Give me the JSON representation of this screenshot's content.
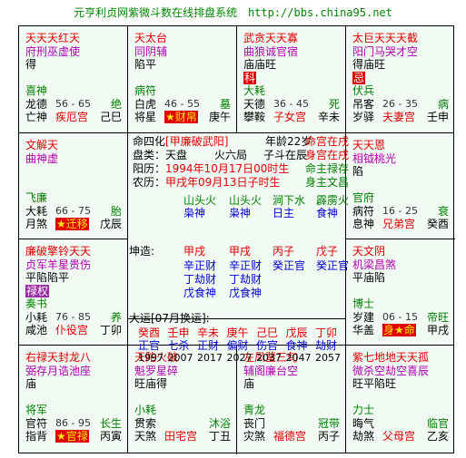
{
  "header": {
    "title": "元亨利贞网紫微斗数在线排盘系统",
    "url": "http://bbs.china95.net"
  },
  "palaces": {
    "p0": {
      "stars_top": [
        [
          "天天天红天",
          "red"
        ],
        [
          "府刑巫虚使",
          "pur"
        ]
      ],
      "line3": [
        [
          "得",
          "blk"
        ]
      ],
      "god": "喜神",
      "r1": [
        "龙德",
        "56 - 65",
        "绝"
      ],
      "r2": [
        "亡神",
        "疾厄宫",
        "己巳"
      ]
    },
    "p1": {
      "stars_top": [
        [
          "天太台",
          "red"
        ],
        [
          "同阴辅",
          "pur"
        ]
      ],
      "line3": [
        [
          "陷平",
          "blk"
        ]
      ],
      "god": "病符",
      "r1": [
        "白虎",
        "46 - 55",
        "墓"
      ],
      "r2": [
        "将星",
        "★财帛",
        "庚午"
      ]
    },
    "p2": {
      "stars_top": [
        [
          "武贪天天寡",
          "red"
        ],
        [
          "曲狼诚官宿",
          "pur"
        ]
      ],
      "line3": [
        [
          "庙庙旺",
          "blk"
        ]
      ],
      "sihua": "科",
      "god": "大耗",
      "r1": [
        "天德",
        "36 - 45",
        "死"
      ],
      "r2": [
        "攀鞍",
        "子女宫",
        "辛未"
      ]
    },
    "p3": {
      "stars_top": [
        [
          "太巨天天天截",
          "red"
        ],
        [
          "阳门马哭才空",
          "pur"
        ]
      ],
      "line3": [
        [
          "得庙旺",
          "blk"
        ]
      ],
      "sihua": "忌",
      "god": "伏兵",
      "r1": [
        "吊客",
        "26 - 35",
        "病"
      ],
      "r2": [
        "岁驿",
        "夫妻宫",
        "壬申"
      ]
    },
    "p4": {
      "stars_top": [
        [
          "文解天",
          "red"
        ],
        [
          "曲神虚",
          "pur"
        ]
      ],
      "line3": [],
      "god": "飞廉",
      "r1": [
        "大耗",
        "66 - 75",
        "胎"
      ],
      "r2": [
        "月煞",
        "★迁移",
        "戊辰"
      ]
    },
    "p5": {
      "stars_top": [
        [
          "天天恩",
          "red"
        ],
        [
          "相钺桃光",
          "pur"
        ]
      ],
      "line3": [
        [
          "陷",
          "blk"
        ]
      ],
      "god": "官府",
      "r1": [
        "病符",
        "16 - 25",
        "衰"
      ],
      "r2": [
        "息神",
        "兄弟宫",
        "癸酉"
      ]
    },
    "p6": {
      "stars_top": [
        [
          "廉破擎铃天天",
          "red"
        ],
        [
          "贞军羊星贵伤",
          "pur"
        ]
      ],
      "line3": [
        [
          "平陷陷平",
          "blk"
        ]
      ],
      "sihua": "禄权",
      "god": "奏书",
      "r1": [
        "小耗",
        "76 - 85",
        "养"
      ],
      "r2": [
        "咸池",
        "仆役宫",
        "丁卯"
      ]
    },
    "p7": {
      "stars_top": [
        [
          "天文阴",
          "red"
        ],
        [
          "机梁昌煞",
          "pur"
        ]
      ],
      "line3": [
        [
          "平庙陷",
          "blk"
        ]
      ],
      "god": "博士",
      "r1": [
        "岁建",
        "06 - 15",
        "帝旺"
      ],
      "r2": [
        "华盖",
        "身★命",
        "甲戌"
      ]
    },
    "p8": {
      "stars_top": [
        [
          "右禄天封龙八",
          "red"
        ],
        [
          "弼存月诰池座",
          "pur"
        ]
      ],
      "line3": [
        [
          "庙",
          "blk"
        ]
      ],
      "god": "将军",
      "r1": [
        "官符",
        "86 - 95",
        "长生"
      ],
      "r2": [
        "指背",
        "★官禄",
        "丙寅"
      ]
    },
    "p9": {
      "stars_top": [
        [
          "天陀火破",
          "red"
        ],
        [
          "魁罗星碎",
          "pur"
        ]
      ],
      "line3": [
        [
          "旺庙得",
          "blk"
        ]
      ],
      "god": "小耗",
      "r1": [
        "贯索",
        "",
        "沐浴"
      ],
      "r2": [
        "天煞",
        "田宅宫",
        "丁丑"
      ]
    },
    "p10": {
      "stars_top": [
        [
          "左凤蜚三旬",
          "red"
        ],
        [
          "辅阁廉台空",
          "pur"
        ]
      ],
      "line3": [
        [
          "庙",
          "blk"
        ]
      ],
      "god": "青龙",
      "r1": [
        "丧门",
        "",
        "冠带"
      ],
      "r2": [
        "灾煞",
        "福德宫",
        "丙子"
      ]
    },
    "p11": {
      "stars_top": [
        [
          "紫七地地天天孤",
          "red"
        ],
        [
          "微杀空劫空喜辰",
          "pur"
        ]
      ],
      "line3": [
        [
          "旺平陷旺",
          "blk"
        ]
      ],
      "god": "力士",
      "r1": [
        "晦气",
        "",
        "临官"
      ],
      "r2": [
        "劫煞",
        "父母宫",
        "乙亥"
      ]
    }
  },
  "center": {
    "row1_label": "命四化",
    "row1_val": "[甲廉破武阳]",
    "row1_age": "年龄22岁",
    "row1_r": "命宫在戌",
    "row2": "盘类：天盘",
    "row2_b": "火六局",
    "row2_c": "子斗在辰",
    "row2_r": "身宫在戌",
    "row3_a": "阳历：",
    "row3_b": "1994年10月17日00时生",
    "row3_r": "命主禄存",
    "row4_a": "农历：",
    "row4_b": "甲戌年09月13日子时生",
    "row4_r": "身主文昌",
    "liunian": [
      "山头火",
      "山头火",
      "涧下水",
      "霹雳火"
    ],
    "liunian2": [
      "枭神",
      "枭神",
      "日主",
      "食神"
    ],
    "gan": [
      "甲戌",
      "甲戌",
      "丙子",
      "戊子"
    ],
    "zang1": [
      "辛正财",
      "辛正财",
      "癸正官",
      "癸正官"
    ],
    "zang2": [
      "丁劫财",
      "丁劫财",
      "",
      ""
    ],
    "zang3": [
      "戊食神",
      "戊食神",
      "",
      ""
    ],
    "qiangan_label": "坤造:",
    "dayun_label": "大运[07月换运]:",
    "dayun_gz": [
      "癸酉",
      "壬申",
      "辛未",
      "庚午",
      "己巳",
      "戊辰",
      "丁卯"
    ],
    "dayun_ss": [
      "正官",
      "七杀",
      "正财",
      "偏财",
      "伤官",
      "食神",
      "劫财"
    ],
    "dayun_yr": [
      "1997",
      "2007",
      "2017",
      "2027",
      "2037",
      "2047",
      "2057"
    ]
  }
}
